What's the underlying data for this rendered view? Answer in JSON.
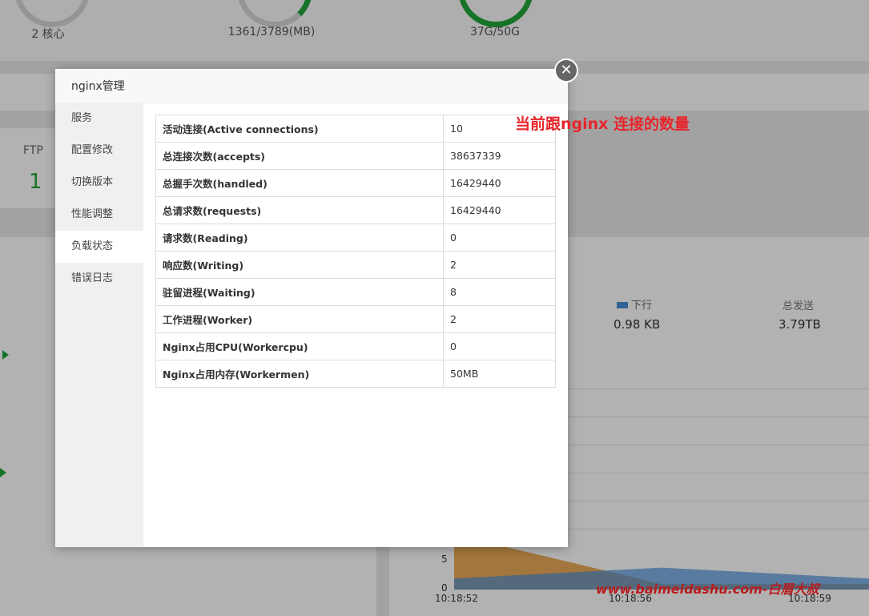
{
  "background": {
    "gauges": [
      {
        "label": "2 核心"
      },
      {
        "label": "1361/3789(MB)"
      },
      {
        "label": "37G/50G"
      }
    ],
    "ftp": {
      "label": "FTP",
      "value": "1"
    },
    "network": {
      "down_label": "下行",
      "down_value": "0.98 KB",
      "sent_label": "总发送",
      "sent_value": "3.79TB"
    },
    "chart_data": {
      "type": "area",
      "title": "",
      "xlabel": "",
      "ylabel": "",
      "x": [
        "10:18:52",
        "10:18:56",
        "10:18:59"
      ],
      "y_ticks": [
        "0",
        "5"
      ],
      "series": [
        {
          "values": [
            10,
            1,
            1
          ]
        },
        {
          "values": [
            2,
            4,
            2
          ]
        }
      ],
      "colors": [
        "#e59a3a",
        "#4a90d9"
      ]
    }
  },
  "modal": {
    "title": "nginx管理",
    "close_icon": "close-icon",
    "sidebar": [
      {
        "label": "服务"
      },
      {
        "label": "配置修改"
      },
      {
        "label": "切换版本"
      },
      {
        "label": "性能调整"
      },
      {
        "label": "负载状态",
        "active": true
      },
      {
        "label": "错误日志"
      }
    ],
    "stats": [
      {
        "key": "活动连接(Active connections)",
        "value": "10"
      },
      {
        "key": "总连接次数(accepts)",
        "value": "38637339"
      },
      {
        "key": "总握手次数(handled)",
        "value": "16429440"
      },
      {
        "key": "总请求数(requests)",
        "value": "16429440"
      },
      {
        "key": "请求数(Reading)",
        "value": "0"
      },
      {
        "key": "响应数(Writing)",
        "value": "2"
      },
      {
        "key": "驻留进程(Waiting)",
        "value": "8"
      },
      {
        "key": "工作进程(Worker)",
        "value": "2"
      },
      {
        "key": "Nginx占用CPU(Workercpu)",
        "value": "0"
      },
      {
        "key": "Nginx占用内存(Workermen)",
        "value": "50MB"
      }
    ]
  },
  "annotation": "当前跟nginx 连接的数量",
  "watermark": "www.baimeidashu.com-白眉大叔"
}
